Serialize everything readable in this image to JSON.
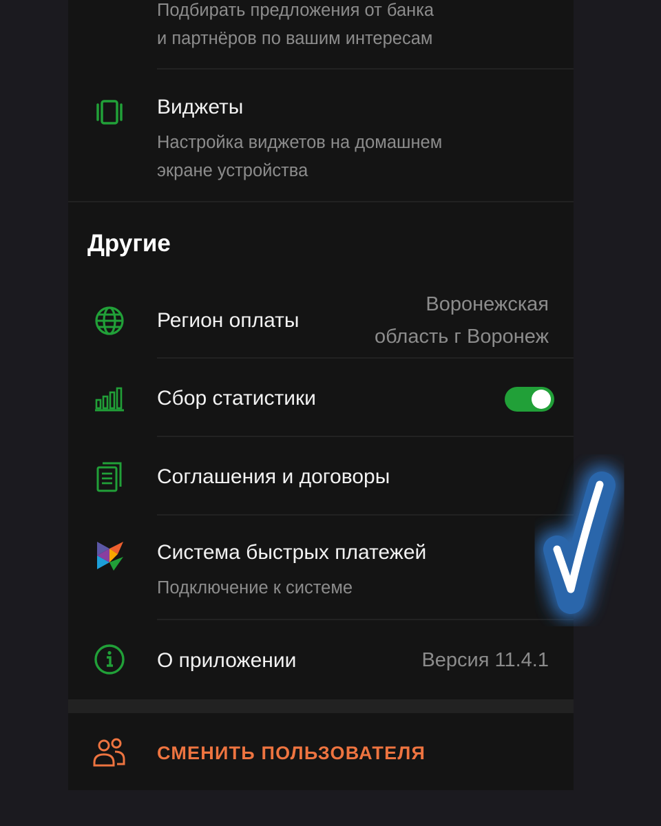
{
  "offers": {
    "subtitle_line1": "Подбирать предложения от банка",
    "subtitle_line2": "и партнёров по вашим интересам"
  },
  "widgets": {
    "title": "Виджеты",
    "subtitle_line1": "Настройка виджетов на домашнем",
    "subtitle_line2": "экране устройства",
    "icon": "widgets-icon"
  },
  "other_section": {
    "title": "Другие",
    "items": [
      {
        "title": "Регион оплаты",
        "value_line1": "Воронежская",
        "value_line2": "область г Воронеж",
        "icon": "globe-icon"
      },
      {
        "title": "Сбор статистики",
        "toggle_on": true,
        "icon": "bar-chart-icon"
      },
      {
        "title": "Соглашения и договоры",
        "icon": "documents-icon"
      },
      {
        "title": "Система быстрых платежей",
        "subtitle": "Подключение к системе",
        "icon": "sbp-logo-icon"
      },
      {
        "title": "О приложении",
        "value": "Версия 11.4.1",
        "icon": "info-icon"
      }
    ]
  },
  "switch_user": {
    "label": "СМЕНИТЬ ПОЛЬЗОВАТЕЛЯ",
    "icon": "users-icon"
  },
  "colors": {
    "accent_green": "#21a038",
    "accent_orange": "#ee7440",
    "background": "#141414",
    "highlight_blue": "#2f6db5"
  }
}
